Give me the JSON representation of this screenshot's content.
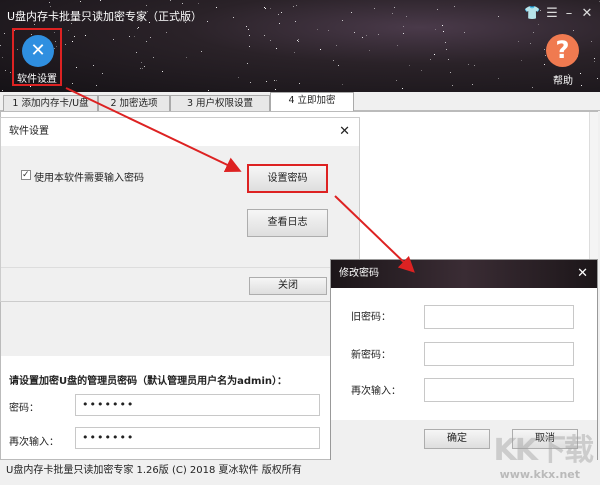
{
  "window": {
    "title": "U盘内存卡批量只读加密专家（正式版）",
    "controls": [
      "skin",
      "menu",
      "minimize",
      "close"
    ]
  },
  "toolbar": {
    "settings_label": "软件设置",
    "help_label": "帮助"
  },
  "tabs": [
    "1 添加内存卡/U盘",
    "2 加密选项",
    "3 用户权限设置",
    "4 立即加密"
  ],
  "active_tab": 3,
  "settings_dialog": {
    "title": "软件设置",
    "checkbox_label": "使用本软件需要输入密码",
    "checkbox_checked": true,
    "set_password": "设置密码",
    "view_log": "查看日志",
    "close": "关闭"
  },
  "main": {
    "heading": "请设置加密U盘的管理员密码（默认管理员用户名为admin）：",
    "password_label": "密码：",
    "password_value": "•••••••",
    "confirm_label": "再次输入：",
    "confirm_value": "•••••••"
  },
  "change_dialog": {
    "title": "修改密码",
    "old_label": "旧密码：",
    "new_label": "新密码：",
    "confirm_label": "再次输入：",
    "ok": "确定",
    "cancel": "取消"
  },
  "status": "U盘内存卡批量只读加密专家  1.26版 (C) 2018 夏冰软件 版权所有",
  "watermark": {
    "logo": "KK下载",
    "url": "www.kkx.net"
  },
  "colors": {
    "accent_red": "#dd2222",
    "settings_icon": "#2f8fe0",
    "help_icon": "#f07a50"
  }
}
